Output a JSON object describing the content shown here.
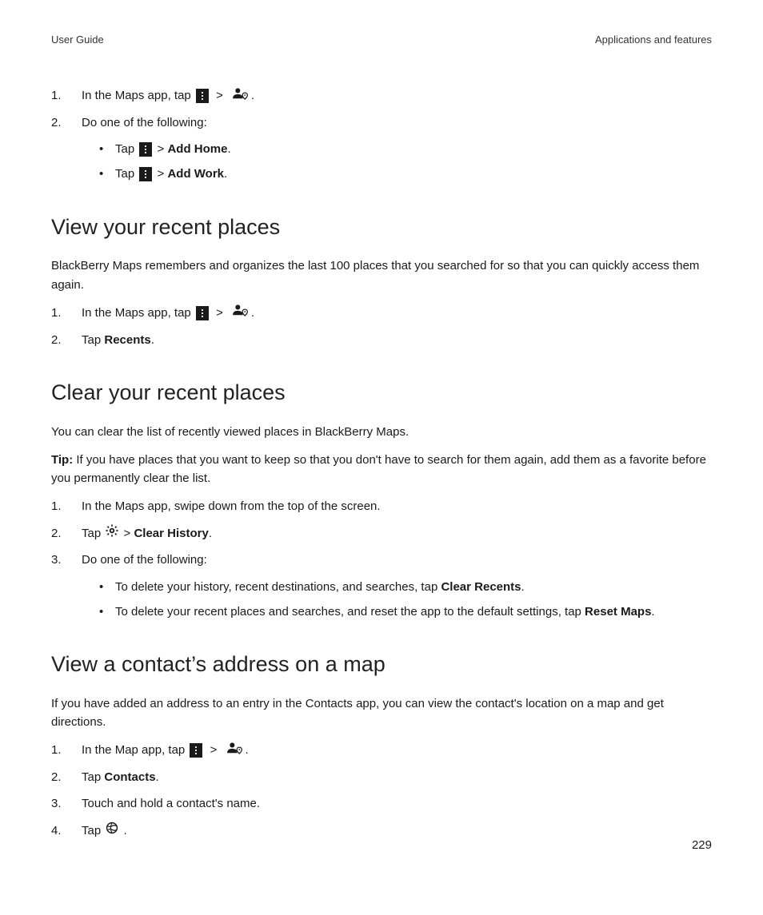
{
  "header": {
    "left": "User Guide",
    "right": "Applications and features"
  },
  "top_steps": {
    "s1_num": "1.",
    "s1_a": "In the Maps app, tap ",
    "s1_gt": ">",
    "s1_end": ".",
    "s2_num": "2.",
    "s2": "Do one of the following:"
  },
  "top_bullets": {
    "b1_a": "Tap ",
    "b1_gt": " > ",
    "b1_bold": "Add Home",
    "b1_end": ".",
    "b2_a": "Tap ",
    "b2_gt": " > ",
    "b2_bold": "Add Work",
    "b2_end": "."
  },
  "sec1": {
    "heading": "View your recent places",
    "p1": "BlackBerry Maps remembers and organizes the last 100 places that you searched for so that you can quickly access them again.",
    "s1_num": "1.",
    "s1_a": "In the Maps app, tap ",
    "s1_gt": ">",
    "s1_end": ".",
    "s2_num": "2.",
    "s2_a": "Tap ",
    "s2_bold": "Recents",
    "s2_end": "."
  },
  "sec2": {
    "heading": "Clear your recent places",
    "p1": "You can clear the list of recently viewed places in BlackBerry Maps.",
    "tip_label": "Tip: ",
    "tip_body": "If you have places that you want to keep so that you don't have to search for them again, add them as a favorite before you permanently clear the list.",
    "s1_num": "1.",
    "s1": "In the Maps app, swipe down from the top of the screen.",
    "s2_num": "2.",
    "s2_a": "Tap ",
    "s2_gt": " > ",
    "s2_bold": "Clear History",
    "s2_end": ".",
    "s3_num": "3.",
    "s3": "Do one of the following:",
    "b1_a": "To delete your history, recent destinations, and searches, tap ",
    "b1_bold": "Clear Recents",
    "b1_end": ".",
    "b2_a": "To delete your recent places and searches, and reset the app to the default settings, tap ",
    "b2_bold": "Reset Maps",
    "b2_end": "."
  },
  "sec3": {
    "heading": "View a contact’s address on a map",
    "p1": "If you have added an address to an entry in the Contacts app, you can view the contact's location on a map and get directions.",
    "s1_num": "1.",
    "s1_a": "In the Map app, tap ",
    "s1_gt": ">",
    "s1_end": ".",
    "s2_num": "2.",
    "s2_a": "Tap ",
    "s2_bold": "Contacts",
    "s2_end": ".",
    "s3_num": "3.",
    "s3": "Touch and hold a contact's name.",
    "s4_num": "4.",
    "s4_a": "Tap ",
    "s4_end": "."
  },
  "page_number": "229"
}
